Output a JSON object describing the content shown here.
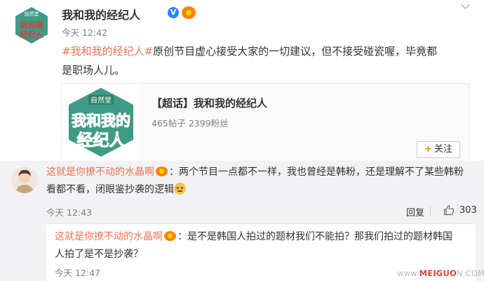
{
  "post": {
    "author": "我和我的经纪人",
    "time": "今天 12:42",
    "hashtag": "#我和我的经纪人#",
    "text_line1": "原创节目虚心接受大家的一切建议，但不接受碰瓷喔，毕竟都",
    "text_line2": "是职场人儿。",
    "avatar_logo_top": "自然堂",
    "avatar_logo_text": "我和我的经纪人"
  },
  "card": {
    "title": "【超话】我和我的经纪人",
    "stats": "465帖子 2399粉丝",
    "follow_label": "关注",
    "thumb_logo_top": "自然堂",
    "thumb_logo_line1": "我和我的",
    "thumb_logo_line2": "经纪人"
  },
  "comment": {
    "user": "这就是你撩不动的水晶啊",
    "text_line1": "：两个节目一点都不一样，我也曾经是韩粉，还是理解不了某些韩粉",
    "text_line2": "看都不看，闭眼鉴抄袭的逻辑",
    "time": "今天 12:43",
    "reply_label": "回复",
    "likes": "303"
  },
  "reply": {
    "user": "这就是你撩不动的水晶啊",
    "text_line1": "：是不是韩国人拍过的题材我们不能拍？那我们拍过的题材韩国",
    "text_line2": "人拍了是不是抄袭？",
    "time": "今天 12:47"
  },
  "watermark": {
    "prefix": "www.",
    "brand": "MEIGUO",
    "suffix": "N.COM"
  },
  "colors": {
    "accent": "#eb7350",
    "panel": "#f2f2f5",
    "brand_orange": "#ff8200",
    "logo_red": "#e03a3f",
    "logo_green": "#3e9b85"
  }
}
